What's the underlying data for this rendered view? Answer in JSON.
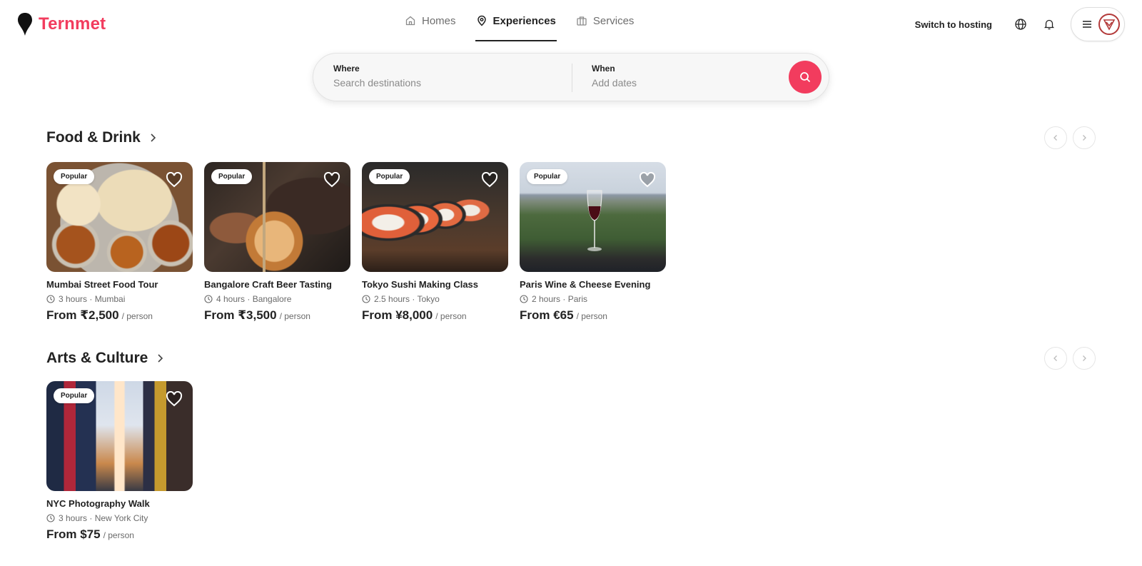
{
  "brand": {
    "name": "Ternmet",
    "accent": "#f23c5e"
  },
  "nav": {
    "tabs": [
      {
        "label": "Homes",
        "icon": "house-icon"
      },
      {
        "label": "Experiences",
        "icon": "map-pin-icon",
        "active": true
      },
      {
        "label": "Services",
        "icon": "bell-service-icon"
      }
    ]
  },
  "header": {
    "host_link": "Switch to hosting",
    "globe_icon": "globe-icon",
    "notifications_icon": "bell-icon",
    "menu_icon": "hamburger-icon"
  },
  "search": {
    "where_label": "Where",
    "where_placeholder": "Search destinations",
    "when_label": "When",
    "when_placeholder": "Add dates",
    "button_icon": "search-icon"
  },
  "sections": [
    {
      "title": "Food & Drink",
      "cards": [
        {
          "badge": "Popular",
          "title": "Mumbai Street Food Tour",
          "meta": "3 hours · Mumbai",
          "price": "From ₹2,500",
          "per": "/ person"
        },
        {
          "badge": "Popular",
          "title": "Bangalore Craft Beer Tasting",
          "meta": "4 hours · Bangalore",
          "price": "From ₹3,500",
          "per": "/ person"
        },
        {
          "badge": "Popular",
          "title": "Tokyo Sushi Making Class",
          "meta": "2.5 hours · Tokyo",
          "price": "From ¥8,000",
          "per": "/ person"
        },
        {
          "badge": "Popular",
          "title": "Paris Wine & Cheese Evening",
          "meta": "2 hours · Paris",
          "price": "From €65",
          "per": "/ person"
        }
      ]
    },
    {
      "title": "Arts & Culture",
      "cards": [
        {
          "badge": "Popular",
          "title": "NYC Photography Walk",
          "meta": "3 hours · New York City",
          "price": "From $75",
          "per": "/ person"
        }
      ]
    }
  ]
}
